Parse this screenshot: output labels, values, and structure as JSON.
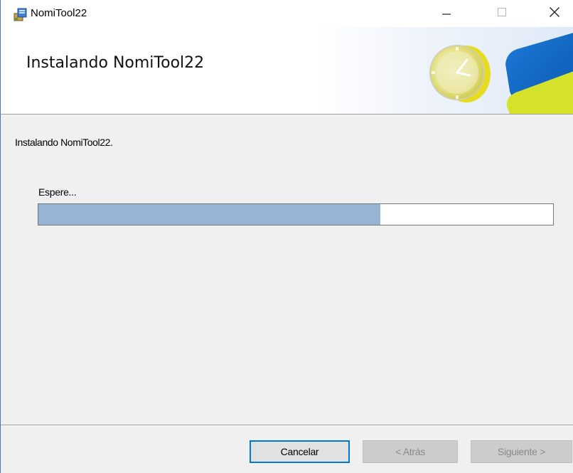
{
  "window": {
    "title": "NomiTool22",
    "icon": "installer-package-icon",
    "controls": {
      "minimize": "minimize-icon",
      "maximize": "maximize-icon",
      "close": "close-icon"
    }
  },
  "header": {
    "title": "Instalando NomiTool22",
    "banner_icon": "clock-icon"
  },
  "main": {
    "status_text": "Instalando NomiTool22.",
    "wait_label": "Espere...",
    "progress": {
      "value": 0.665
    }
  },
  "footer": {
    "cancel_label": "Cancelar",
    "back_label": "< Atrás",
    "next_label": "Siguiente >"
  },
  "colors": {
    "progress_fill": "#98b4d4",
    "focus_border": "#0078d7",
    "banner_blue": "#1a6fcf",
    "banner_yellow": "#d4e22a"
  }
}
